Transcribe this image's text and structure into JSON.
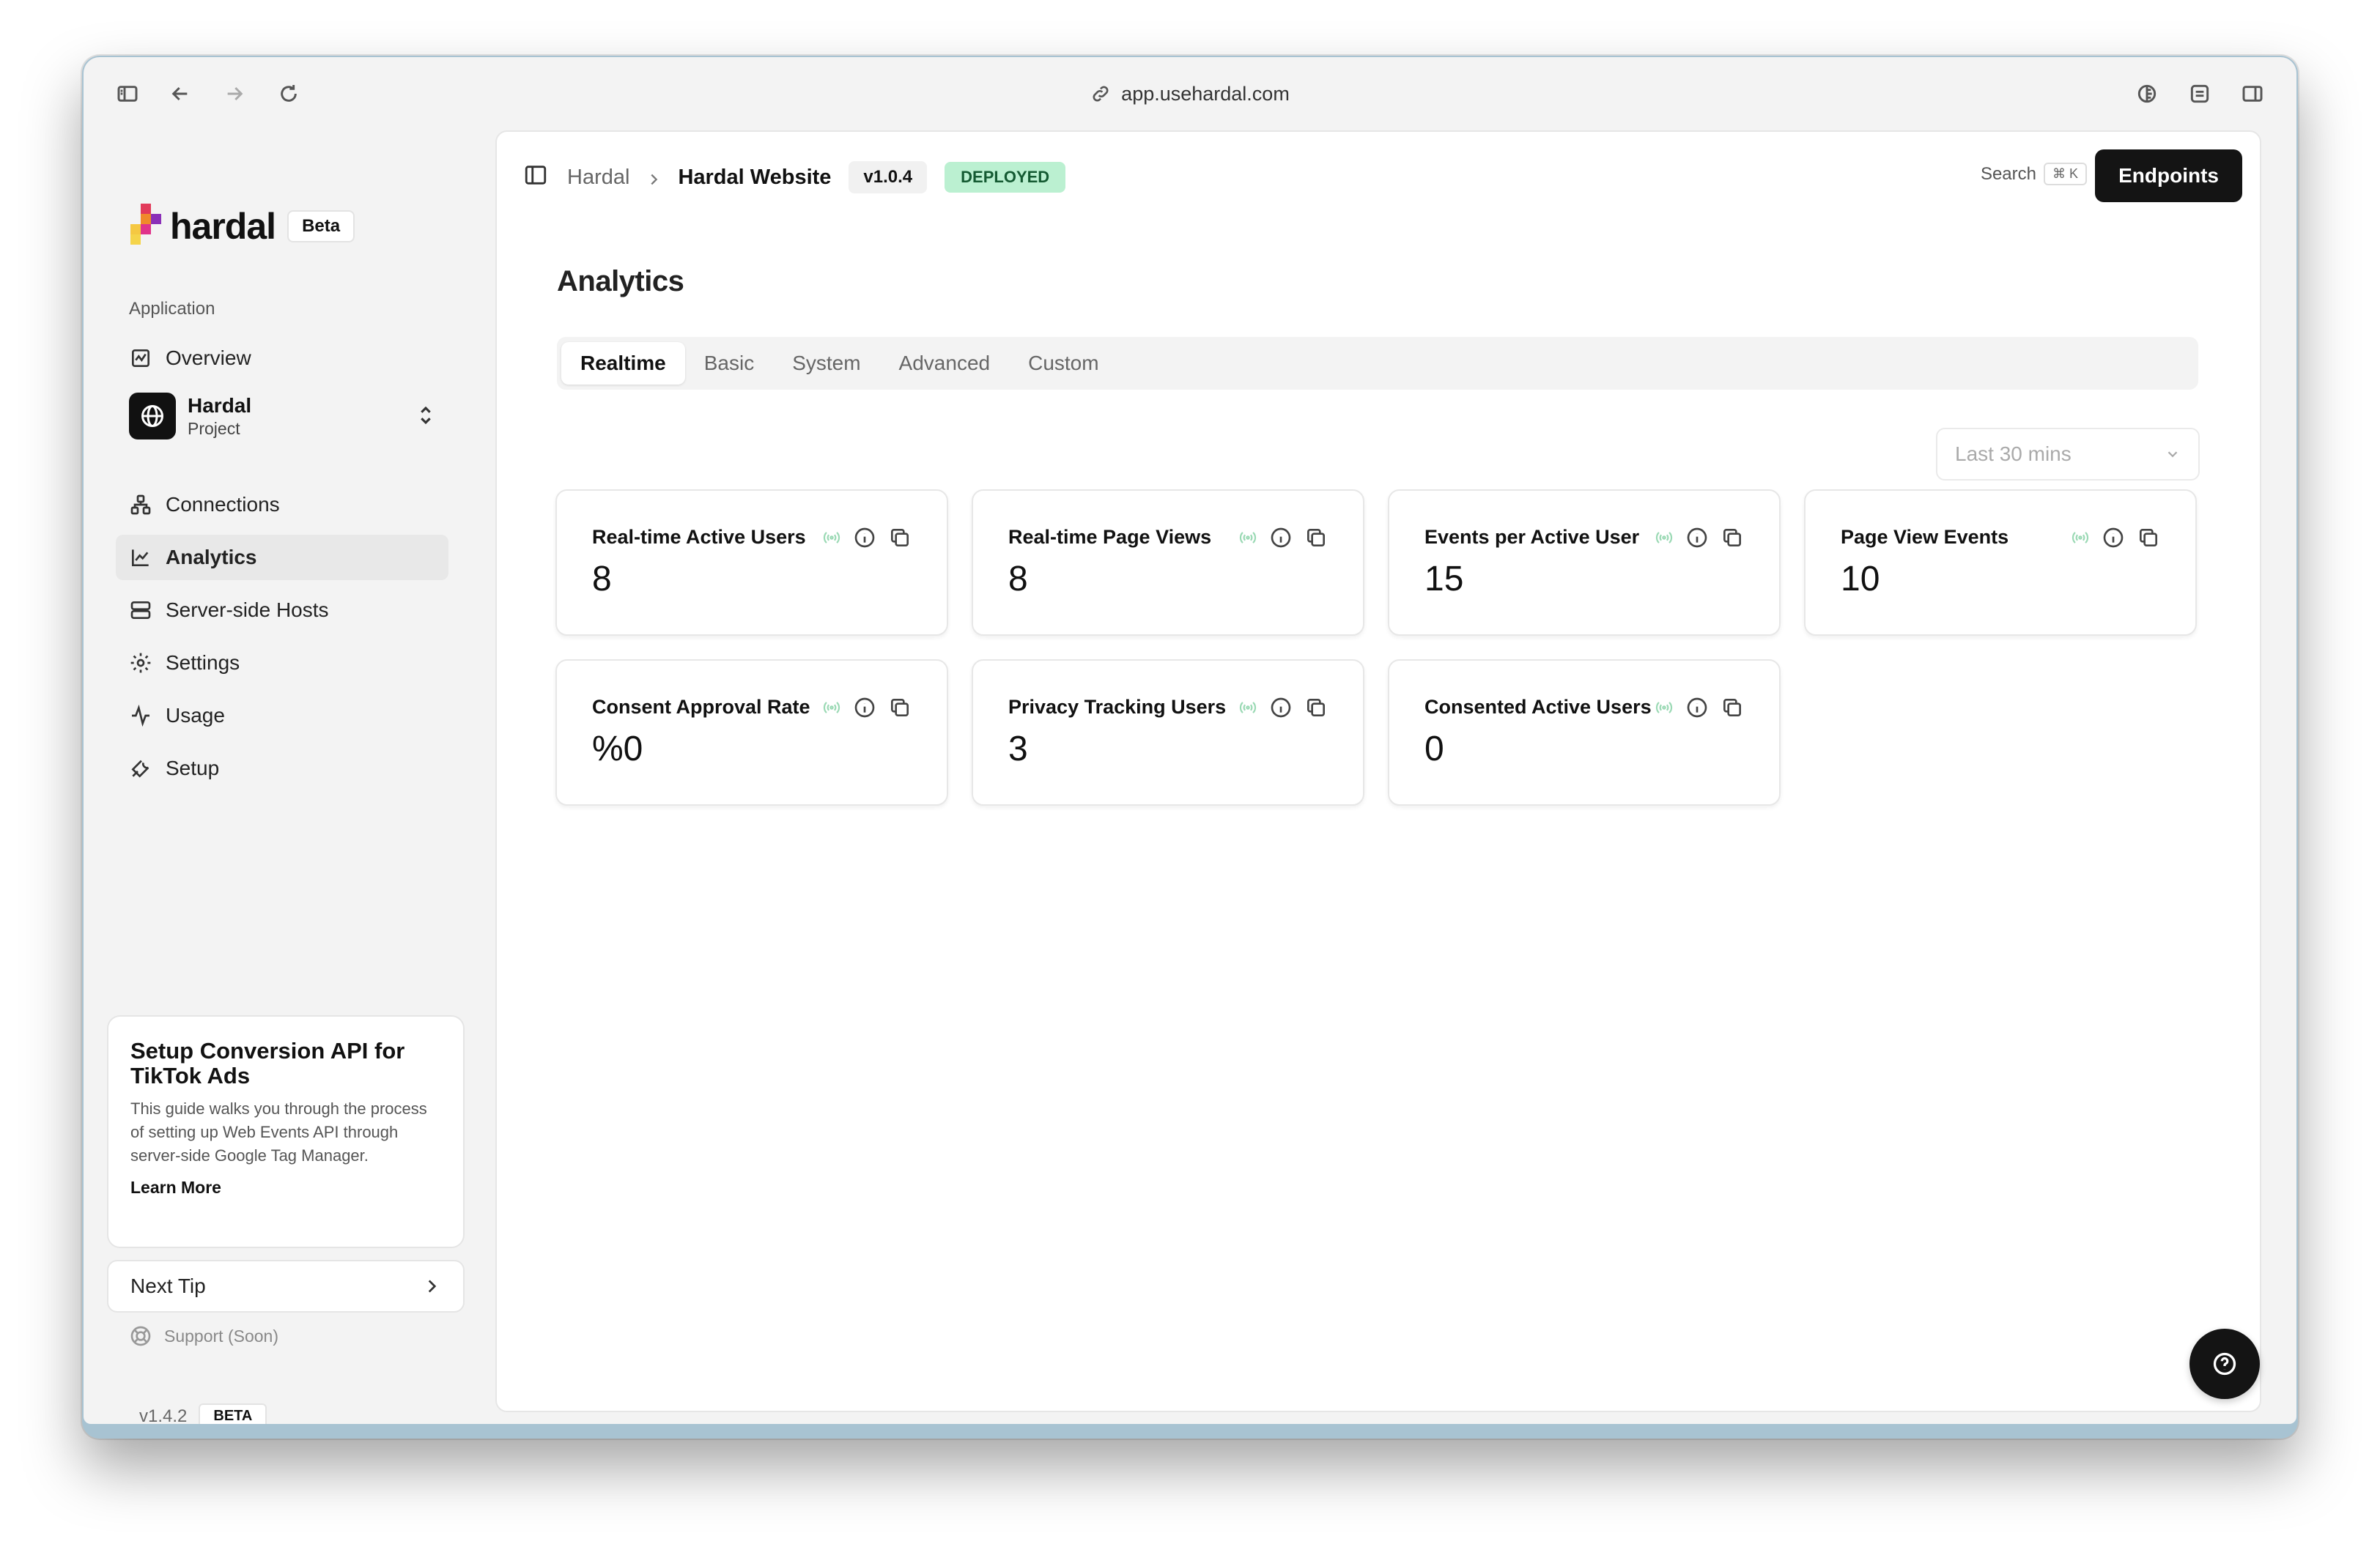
{
  "browser": {
    "url": "app.usehardal.com"
  },
  "sidebar": {
    "brand": "hardal",
    "beta_label": "Beta",
    "section_label": "Application",
    "overview": "Overview",
    "project": {
      "name": "Hardal",
      "sub": "Project"
    },
    "items": [
      {
        "label": "Connections",
        "icon": "connections-icon"
      },
      {
        "label": "Analytics",
        "icon": "chart-line-icon",
        "active": true
      },
      {
        "label": "Server-side Hosts",
        "icon": "server-icon"
      },
      {
        "label": "Settings",
        "icon": "gear-icon"
      },
      {
        "label": "Usage",
        "icon": "activity-icon"
      },
      {
        "label": "Setup",
        "icon": "wrench-icon"
      }
    ],
    "tip": {
      "title": "Setup Conversion API for TikTok Ads",
      "body": "This guide walks you through the process of setting up Web Events API through server-side Google Tag Manager.",
      "link": "Learn More"
    },
    "next_tip": "Next Tip",
    "support": "Support (Soon)",
    "version": "v1.4.2",
    "version_tag": "BETA"
  },
  "header": {
    "crumb_root": "Hardal",
    "crumb_current": "Hardal Website",
    "version": "v1.0.4",
    "status": "DEPLOYED",
    "search_label": "Search",
    "search_shortcut": "⌘ K",
    "endpoints_button": "Endpoints"
  },
  "main": {
    "title": "Analytics",
    "tabs": [
      "Realtime",
      "Basic",
      "System",
      "Advanced",
      "Custom"
    ],
    "active_tab": "Realtime",
    "time_range": "Last 30 mins",
    "metrics": [
      {
        "label": "Real-time Active Users",
        "value": "8"
      },
      {
        "label": "Real-time Page Views",
        "value": "8"
      },
      {
        "label": "Events per Active User",
        "value": "15"
      },
      {
        "label": "Page View Events",
        "value": "10"
      },
      {
        "label": "Consent Approval Rate",
        "value": "%0"
      },
      {
        "label": "Privacy Tracking Users",
        "value": "3"
      },
      {
        "label": "Consented Active Users",
        "value": "0"
      }
    ]
  },
  "colors": {
    "accent_dark": "#141414",
    "deployed_bg": "#bbf0d1",
    "live_green": "#9ad9b4",
    "window_frame": "#a8c3d2"
  }
}
